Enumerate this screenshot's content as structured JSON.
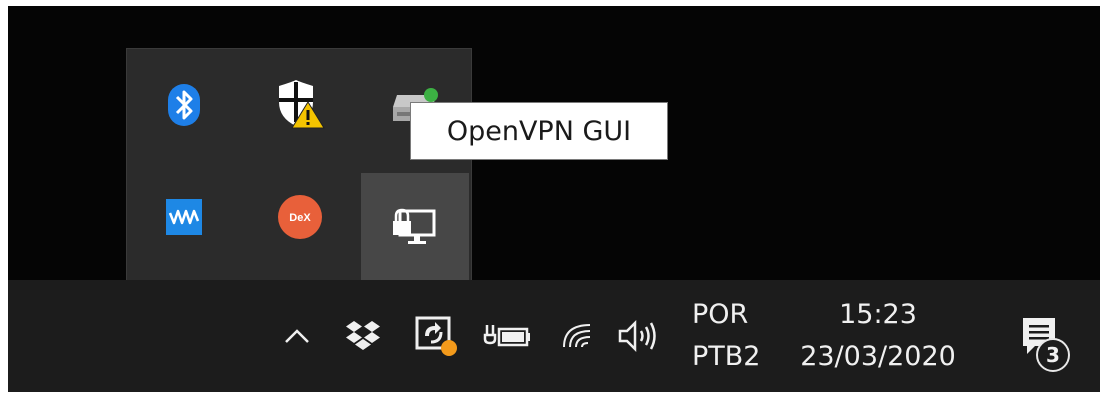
{
  "tooltip": {
    "text": "OpenVPN GUI"
  },
  "tray_overflow": {
    "items": [
      {
        "name": "Bluetooth",
        "icon": "bluetooth-icon"
      },
      {
        "name": "Windows Security",
        "icon": "windows-security-warning-icon"
      },
      {
        "name": "Network drive",
        "icon": "network-drive-icon"
      },
      {
        "name": "Waves",
        "icon": "waves-icon"
      },
      {
        "name": "DeX",
        "icon": "dex-icon",
        "label": "DeX"
      },
      {
        "name": "OpenVPN GUI",
        "icon": "openvpn-monitor-lock-icon",
        "hovered": true
      }
    ]
  },
  "taskbar": {
    "language_code": "POR",
    "keyboard_layout": "PTB2",
    "time": "15:23",
    "date": "23/03/2020",
    "notification_count": "3",
    "icons": [
      "chevron-up-icon",
      "dropbox-icon",
      "sync-status-icon",
      "battery-icon",
      "wifi-icon",
      "volume-icon",
      "action-center-icon"
    ]
  },
  "colors": {
    "taskbar_bg": "#1c1c1c",
    "flyout_bg": "#2b2b2b",
    "bluetooth_blue": "#1e7fe8",
    "dex_orange": "#e8603a",
    "waves_blue": "#1e88e5",
    "warning_yellow": "#f3c300",
    "sync_orange": "#f39a1b"
  }
}
